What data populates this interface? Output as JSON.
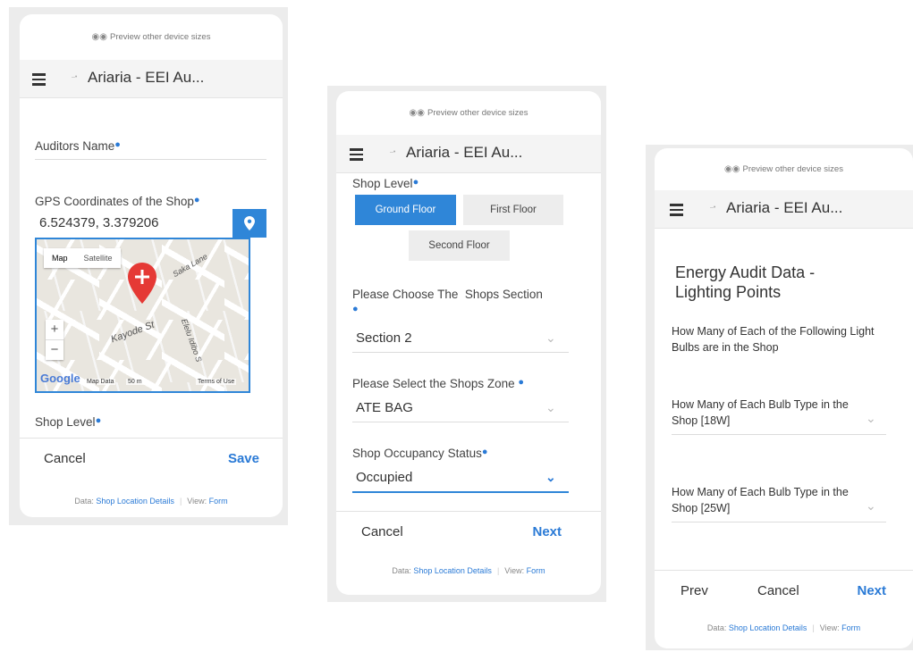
{
  "common": {
    "preview_text": "Preview other device sizes",
    "app_title": "Ariaria - EEI Au...",
    "data_label": "Data:",
    "data_link": "Shop Location Details",
    "view_label": "View:",
    "view_link": "Form"
  },
  "screen1": {
    "auditors_name_label": "Auditors Name",
    "gps_label": "GPS Coordinates of the Shop",
    "gps_value": "6.524379, 3.379206",
    "map": {
      "tab_map": "Map",
      "tab_satellite": "Satellite",
      "street_1": "Kayode St",
      "street_2": "Saka Lane",
      "street_3": "Elelu Idibo S",
      "logo": "Google",
      "attr_data": "Map Data",
      "attr_scale": "50 m",
      "attr_terms": "Terms of Use",
      "zoom_in": "+",
      "zoom_out": "−"
    },
    "shop_level_label": "Shop Level",
    "cancel_label": "Cancel",
    "save_label": "Save"
  },
  "screen2": {
    "shop_level_label": "Shop Level",
    "level_options": [
      "Ground Floor",
      "First Floor",
      "Second Floor"
    ],
    "selected_level": "Ground Floor",
    "section_label": "Please Choose The  Shops Section",
    "section_value": "Section 2",
    "zone_label": "Please Select the Shops Zone",
    "zone_value": "ATE BAG",
    "occupancy_label": "Shop Occupancy Status",
    "occupancy_value": "Occupied",
    "cancel_label": "Cancel",
    "next_label": "Next"
  },
  "screen3": {
    "heading": "Energy Audit Data - Lighting Points",
    "intro": "How Many of Each of the Following Light Bulbs are in the Shop",
    "q1": "How Many of Each Bulb Type in the Shop [18W]",
    "q2": "How Many of Each Bulb Type in the Shop [25W]",
    "prev_label": "Prev",
    "cancel_label": "Cancel",
    "next_label": "Next"
  },
  "colors": {
    "accent": "#2f86d8",
    "link": "#2a7ad6",
    "panel_bg": "#ececec"
  }
}
